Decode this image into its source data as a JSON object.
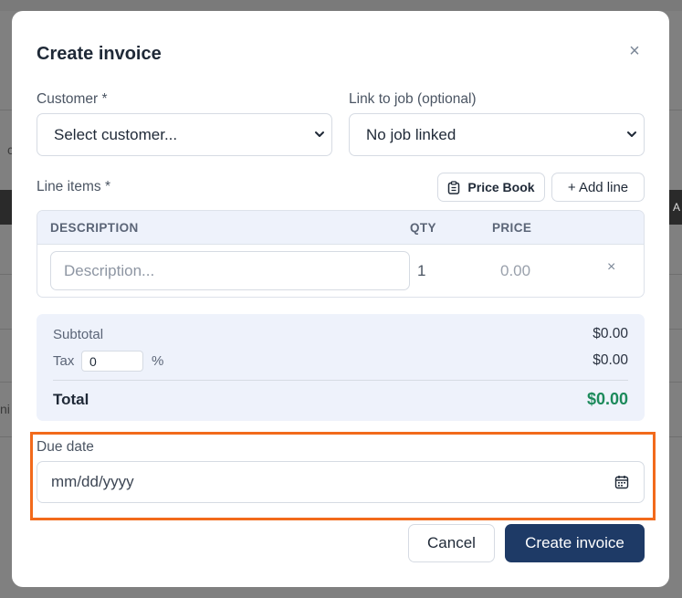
{
  "background": {
    "right_fragment": "A",
    "left_fragment_1": "c",
    "left_fragment_2": "ni"
  },
  "modal": {
    "title": "Create invoice",
    "close_glyph": "×",
    "close_icon": "close-icon"
  },
  "customer": {
    "label": "Customer *",
    "value": "Select customer..."
  },
  "job": {
    "label": "Link to job (optional)",
    "value": "No job linked"
  },
  "line_items": {
    "label": "Line items *",
    "price_book_label": "Price Book",
    "price_book_icon": "clipboard-icon",
    "add_line_label": "+ Add line",
    "columns": [
      "DESCRIPTION",
      "QTY",
      "PRICE"
    ],
    "rows": [
      {
        "description_placeholder": "Description...",
        "qty": "1",
        "price": "0.00",
        "remove_glyph": "×"
      }
    ]
  },
  "summary": {
    "subtotal_label": "Subtotal",
    "subtotal_value": "$0.00",
    "tax_label": "Tax",
    "tax_rate": "0",
    "tax_unit": "%",
    "tax_value": "$0.00",
    "total_label": "Total",
    "total_value": "$0.00"
  },
  "due_date": {
    "label": "Due date",
    "placeholder": "mm/dd/yyyy",
    "icon": "calendar-icon"
  },
  "footer": {
    "cancel_label": "Cancel",
    "create_label": "Create invoice"
  },
  "colors": {
    "primary": "#1e3a66",
    "total_green": "#1c8a5b",
    "highlight": "#f26a1b",
    "panel_bg": "#eef2fb"
  }
}
